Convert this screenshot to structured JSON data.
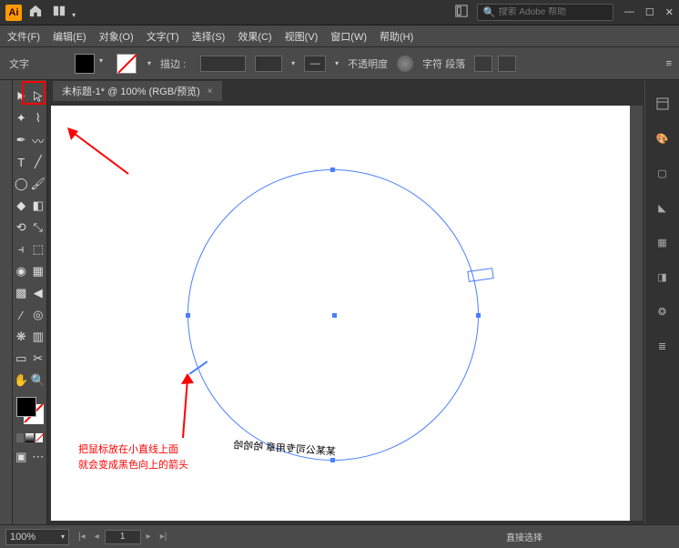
{
  "titlebar": {
    "logo": "Ai",
    "search_placeholder": "搜索 Adobe 帮助"
  },
  "menu": {
    "file": "文件(F)",
    "edit": "编辑(E)",
    "object": "对象(O)",
    "type": "文字(T)",
    "select": "选择(S)",
    "effect": "效果(C)",
    "view": "视图(V)",
    "window": "窗口(W)",
    "help": "帮助(H)"
  },
  "control": {
    "mode": "文字",
    "stroke_label": "描边 :",
    "opacity_label": "不透明度",
    "char_para": "字符 段落"
  },
  "doc": {
    "tab_title": "未标题-1* @ 100% (RGB/预览)"
  },
  "canvas": {
    "path_text": "某某公司专用章 哈哈哈",
    "annotation_l1": "把鼠标放在小直线上面",
    "annotation_l2": "就会变成黑色向上的箭头"
  },
  "status": {
    "zoom": "100%",
    "page": "1",
    "tool": "直接选择"
  }
}
